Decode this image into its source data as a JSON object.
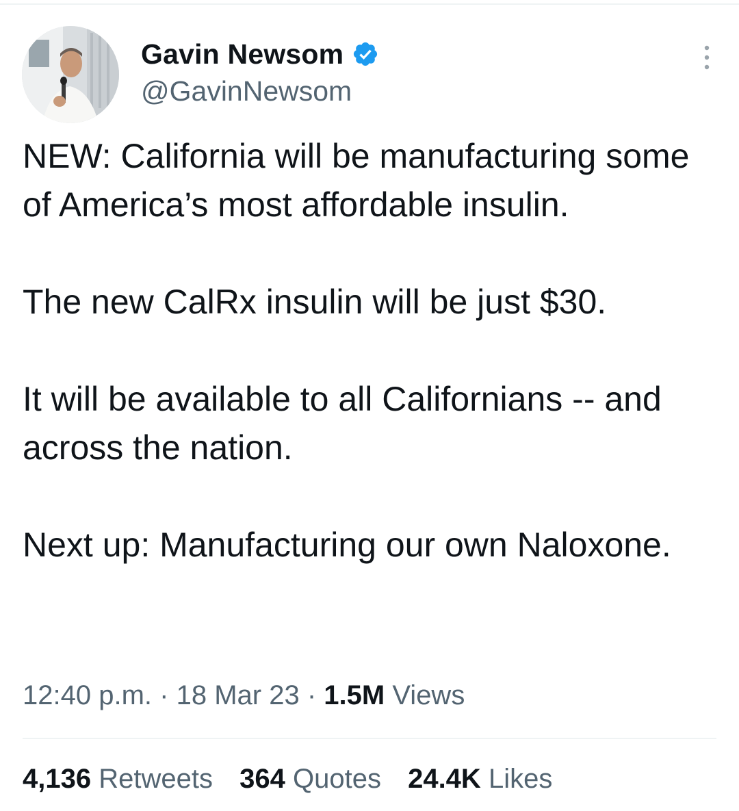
{
  "author": {
    "display_name": "Gavin Newsom",
    "handle": "@GavinNewsom",
    "verified_icon": "verified-badge-icon",
    "verified_color": "#1d9bf0"
  },
  "tweet": {
    "paragraphs": [
      "NEW: California will be manufacturing some of America’s most affordable insulin.",
      "The new CalRx insulin will be just $30.",
      "It will be available to all Californians -- and across the nation.",
      "Next up: Manufacturing our own Naloxone."
    ]
  },
  "meta": {
    "time": "12:40 p.m.",
    "separator": "·",
    "date": "18 Mar 23",
    "views_count": "1.5M",
    "views_label": "Views"
  },
  "stats": {
    "retweets_count": "4,136",
    "retweets_label": "Retweets",
    "quotes_count": "364",
    "quotes_label": "Quotes",
    "likes_count": "24.4K",
    "likes_label": "Likes"
  },
  "colors": {
    "text_primary": "#0f1419",
    "text_secondary": "#536471",
    "divider": "#eff3f4"
  }
}
